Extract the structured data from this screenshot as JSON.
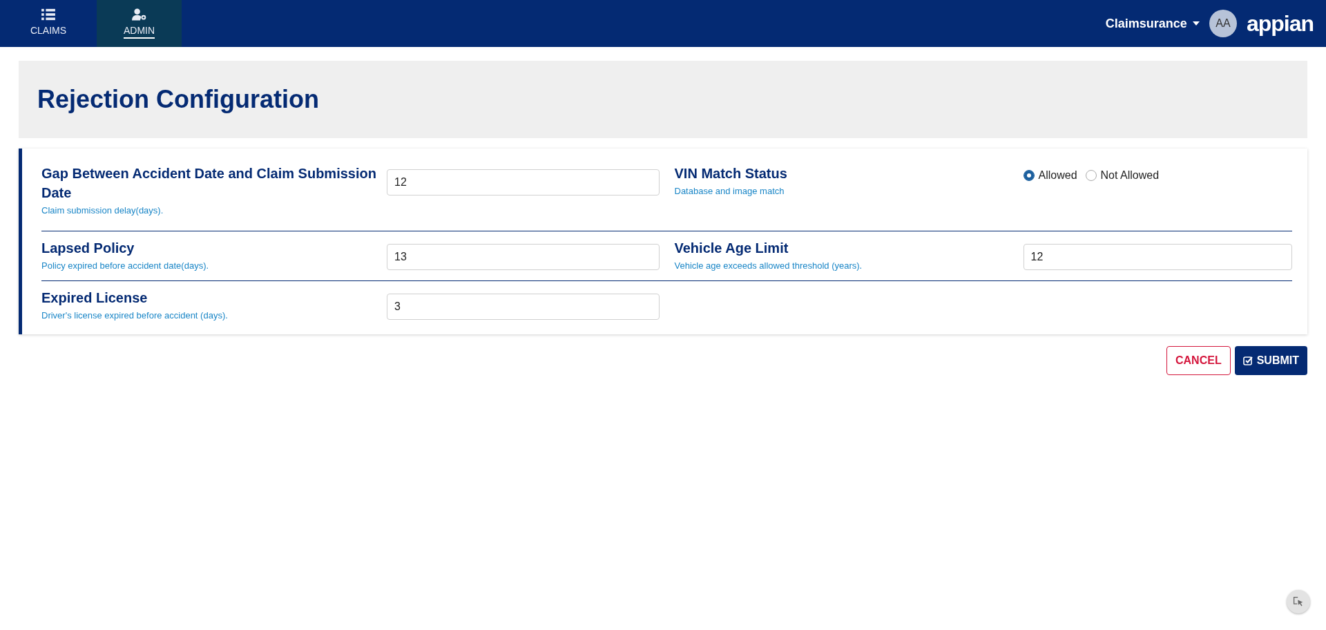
{
  "nav": {
    "tabs": [
      {
        "label": "CLAIMS",
        "kind": "list",
        "selected": false
      },
      {
        "label": "ADMIN",
        "kind": "admin",
        "selected": true
      }
    ],
    "site_menu": "Claimsurance",
    "avatar": "AA",
    "logo": "appian"
  },
  "page_title": "Rejection Configuration",
  "form": {
    "rows": [
      {
        "fields": [
          {
            "kind": "number",
            "label": "Gap Between Accident Date and Claim Submission Date",
            "hint": "Claim submission delay(days).",
            "value": "12"
          },
          {
            "kind": "radio",
            "label": "VIN Match Status",
            "hint": "Database and image match",
            "options": [
              {
                "label": "Allowed",
                "selected": true
              },
              {
                "label": "Not Allowed",
                "selected": false
              }
            ]
          }
        ]
      },
      {
        "fields": [
          {
            "kind": "number",
            "label": "Lapsed Policy",
            "hint": "Policy expired before accident date(days).",
            "value": "13"
          },
          {
            "kind": "number",
            "label": "Vehicle Age Limit",
            "hint": "Vehicle age exceeds allowed threshold (years).",
            "value": "12"
          }
        ]
      },
      {
        "fields": [
          {
            "kind": "number",
            "label": "Expired License",
            "hint": "Driver's license expired before accident (days).",
            "value": "3"
          }
        ]
      }
    ]
  },
  "buttons": [
    {
      "kind": "secondary",
      "label": "CANCEL"
    },
    {
      "kind": "primary",
      "label": "SUBMIT"
    }
  ]
}
